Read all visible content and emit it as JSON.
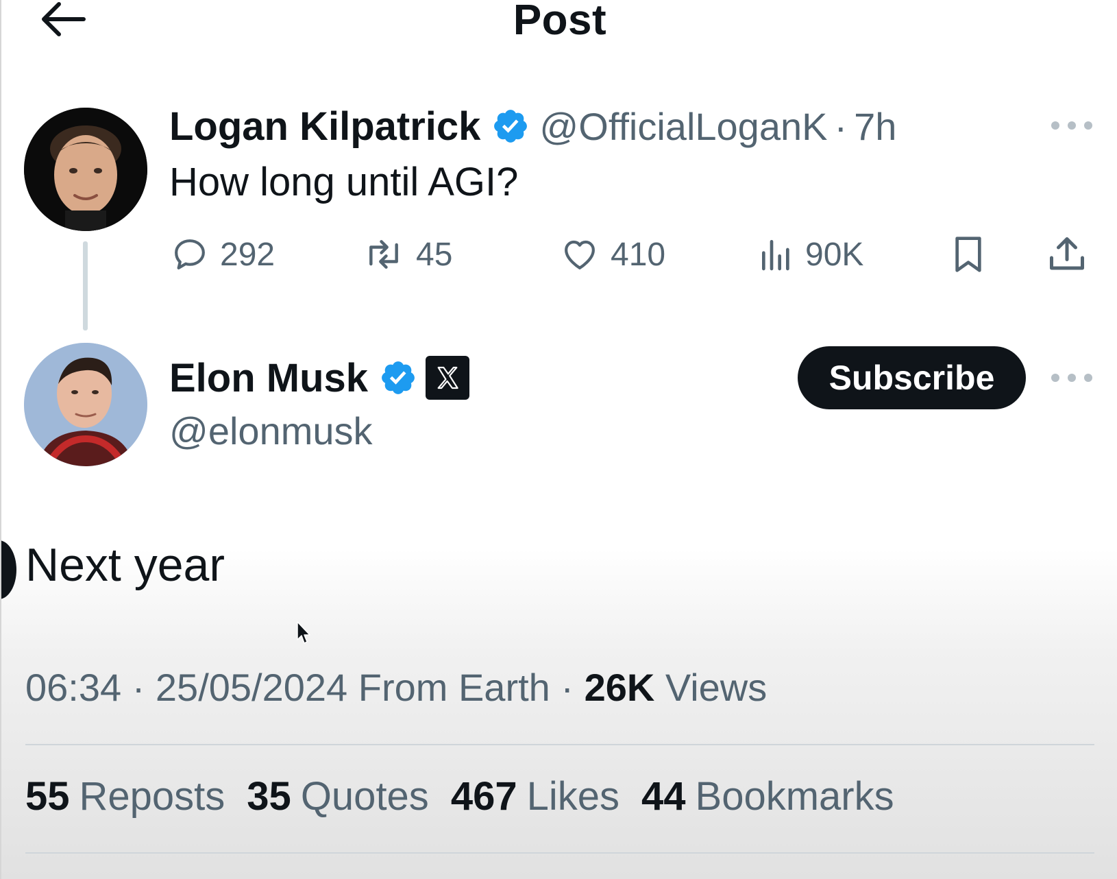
{
  "header": {
    "title": "Post",
    "back_icon": "arrow-left-icon"
  },
  "original_post": {
    "display_name": "Logan Kilpatrick",
    "verified_icon": "verified-badge-icon",
    "handle": "@OfficialLoganK",
    "separator": "·",
    "time": "7h",
    "text": "How long until AGI?",
    "more_icon": "more-horizontal-icon",
    "actions": {
      "replies": "292",
      "reposts": "45",
      "likes": "410",
      "views": "90K"
    }
  },
  "reply_post": {
    "display_name": "Elon Musk",
    "verified_icon": "verified-badge-icon",
    "affiliation_icon": "x-logo-icon",
    "handle": "@elonmusk",
    "subscribe_label": "Subscribe",
    "more_icon": "more-horizontal-icon",
    "text": "Next year",
    "meta": {
      "time": "06:34",
      "sep1": " · ",
      "date": "25/05/2024",
      "source": " From Earth",
      "sep2": " · ",
      "views_count": "26K",
      "views_label": " Views"
    },
    "stats": [
      {
        "count": "55",
        "label": "Reposts"
      },
      {
        "count": "35",
        "label": "Quotes"
      },
      {
        "count": "467",
        "label": "Likes"
      },
      {
        "count": "44",
        "label": "Bookmarks"
      }
    ]
  },
  "colors": {
    "text_primary": "#0f1419",
    "text_secondary": "#536471",
    "verified_blue": "#1d9bf0",
    "button_dark": "#0f1419"
  }
}
